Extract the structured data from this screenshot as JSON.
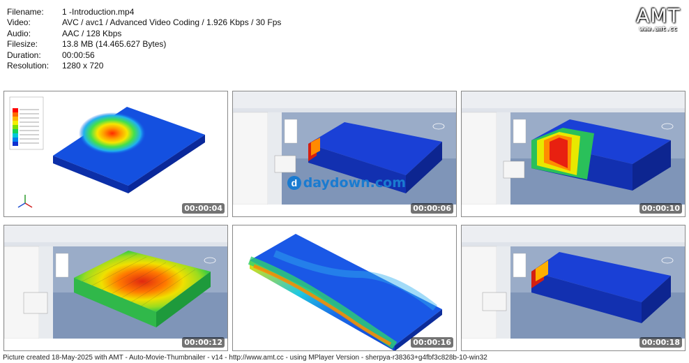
{
  "meta": {
    "filename_label": "Filename:",
    "filename": "1 -Introduction.mp4",
    "video_label": "Video:",
    "video": "AVC / avc1 / Advanced Video Coding / 1.926 Kbps / 30 Fps",
    "audio_label": "Audio:",
    "audio": "AAC / 128 Kbps",
    "filesize_label": "Filesize:",
    "filesize": "13.8 MB (14.465.627 Bytes)",
    "duration_label": "Duration:",
    "duration": "00:00:56",
    "resolution_label": "Resolution:",
    "resolution": "1280 x 720"
  },
  "logo": {
    "text": "AMT",
    "url": "www.amt.cc"
  },
  "watermark": {
    "mark": "d",
    "text": "daydown.com"
  },
  "thumbs": [
    {
      "time": "00:00:04"
    },
    {
      "time": "00:00:06"
    },
    {
      "time": "00:00:10"
    },
    {
      "time": "00:00:12"
    },
    {
      "time": "00:00:16"
    },
    {
      "time": "00:00:18"
    }
  ],
  "footer": "Picture created 18-May-2025 with AMT - Auto-Movie-Thumbnailer - v14 - http://www.amt.cc - using MPlayer Version - sherpya-r38363+g4fbf3c828b-10-win32"
}
